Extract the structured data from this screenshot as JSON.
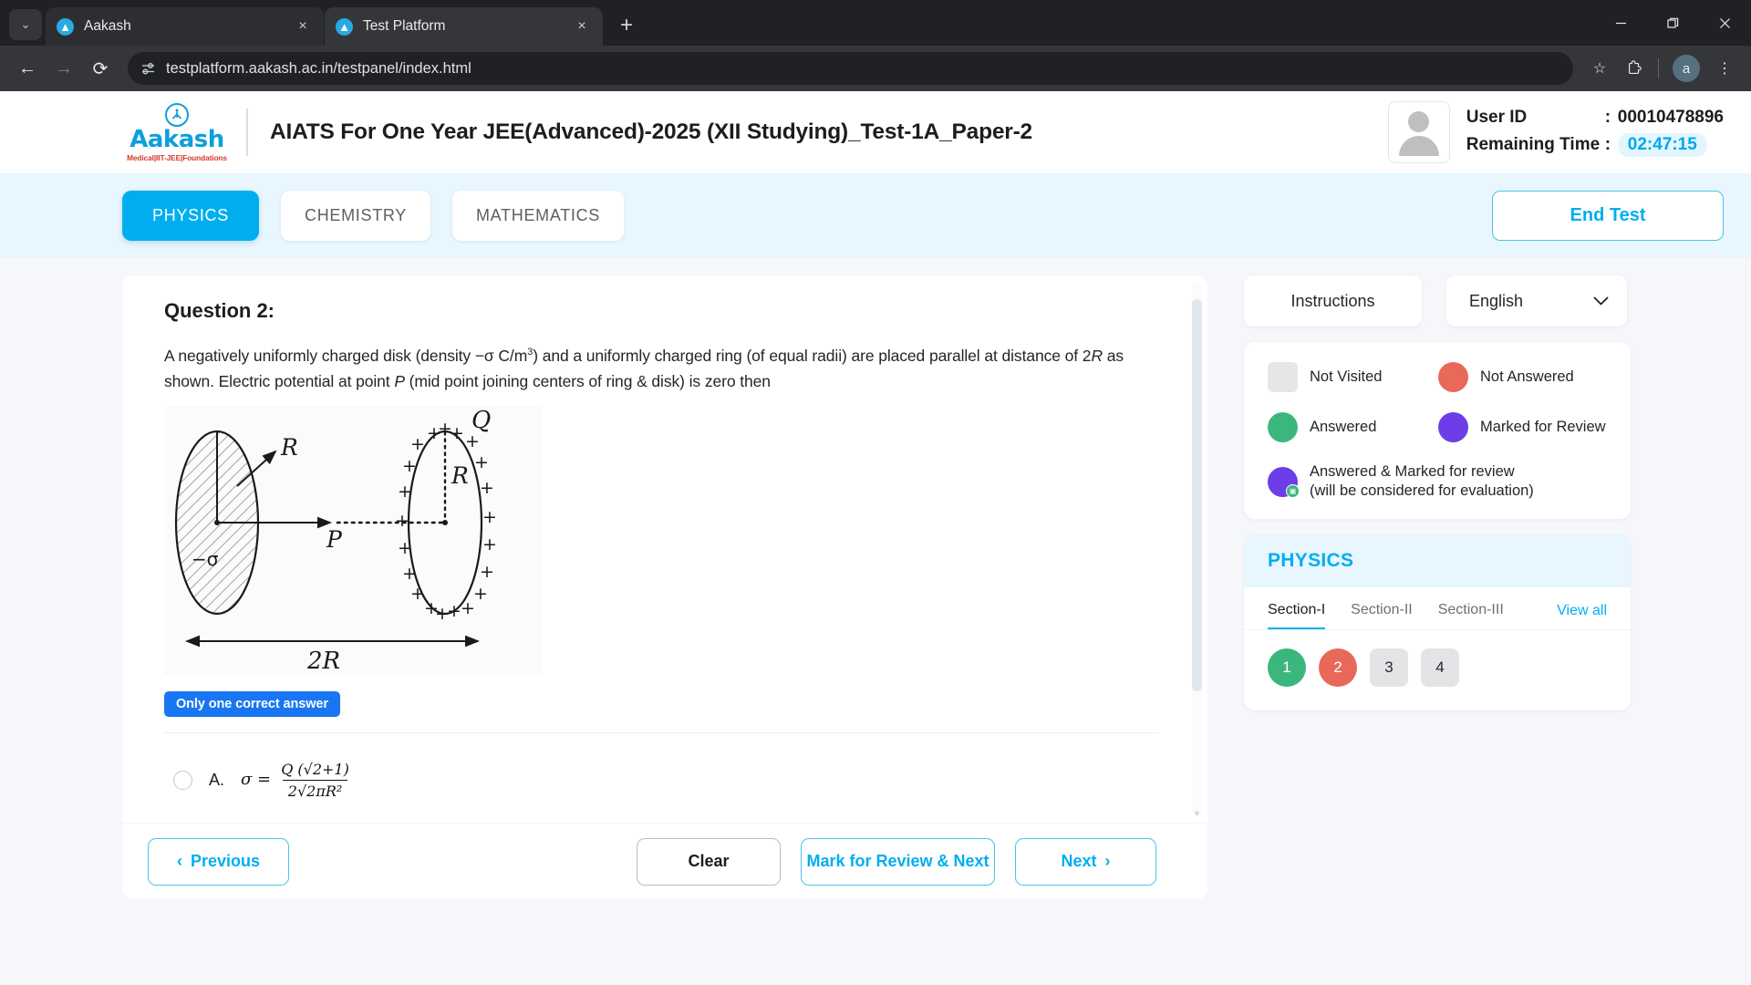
{
  "browser": {
    "tabs": [
      {
        "title": "Aakash",
        "favicon": "aakash-favicon",
        "active": false
      },
      {
        "title": "Test Platform",
        "favicon": "aakash-favicon",
        "active": true
      }
    ],
    "url": "testplatform.aakash.ac.in/testpanel/index.html",
    "profile_initial": "a",
    "new_tab_glyph": "+",
    "tab_close_glyph": "×",
    "tab_search_glyph": "⌄",
    "back_glyph": "←",
    "forward_glyph": "→",
    "reload_glyph": "⟳",
    "site_info_icon": "tune-icon",
    "bookmark_glyph": "☆",
    "extensions_glyph": "⬚",
    "menu_glyph": "⋮",
    "minimize_glyph": "−",
    "maximize_glyph": "❐",
    "close_glyph": "✕"
  },
  "header": {
    "logo_word": "Aakash",
    "logo_tagline": "Medical|IIT-JEE|Foundations",
    "test_title": "AIATS For One Year JEE(Advanced)-2025 (XII Studying)_Test-1A_Paper-2",
    "user_id_label": "User ID",
    "user_id_value": "00010478896",
    "remaining_time_label": "Remaining Time",
    "remaining_time_value": "02:47:15",
    "colon": ":"
  },
  "subject_bar": {
    "tabs": [
      {
        "label": "PHYSICS",
        "active": true
      },
      {
        "label": "CHEMISTRY",
        "active": false
      },
      {
        "label": "MATHEMATICS",
        "active": false
      }
    ],
    "end_test_label": "End Test"
  },
  "question": {
    "title": "Question 2:",
    "text_part1": "A negatively uniformly charged disk (density −σ C/m",
    "text_sup": "3",
    "text_part2": ") and a uniformly charged ring (of equal radii) are placed parallel at distance of 2",
    "italic_R": "R",
    "text_part3": " as shown. Electric potential at point ",
    "italic_P": "P",
    "text_part4": " (mid point joining centers of ring & disk) is zero then",
    "badge": "Only one correct answer",
    "diagram": {
      "label_sigma": "−σ",
      "label_radius_disk": "R",
      "label_point": "P",
      "label_radius_ring": "R",
      "label_charge": "Q",
      "label_distance": "2R",
      "plus_glyph": "+"
    },
    "options": [
      {
        "letter": "A.",
        "lhs": "σ =",
        "numerator": "Q (√2+1)",
        "denominator": "2√2πR²",
        "selected": false
      }
    ]
  },
  "footer": {
    "previous_label": "Previous",
    "previous_glyph": "‹",
    "clear_label": "Clear",
    "mark_review_label": "Mark for Review & Next",
    "next_label": "Next",
    "next_glyph": "›"
  },
  "side_panel": {
    "instructions_label": "Instructions",
    "language_value": "English",
    "chevron_glyph": "⌄",
    "legend": [
      {
        "label": "Not Visited",
        "color": "#e4e6e8",
        "shape": "square"
      },
      {
        "label": "Not Answered",
        "color": "#e8685a",
        "shape": "circle"
      },
      {
        "label": "Answered",
        "color": "#3bb77e",
        "shape": "circle"
      },
      {
        "label": "Marked for Review",
        "color": "#6c3de8",
        "shape": "circle"
      }
    ],
    "legend_wide": {
      "label_line1": "Answered & Marked for review",
      "label_line2": "(will be considered for evaluation)",
      "color": "#6c3de8",
      "badge_color": "#3bb77e",
      "badge_glyph": "▣"
    },
    "palette": {
      "subject": "PHYSICS",
      "sections": [
        {
          "label": "Section-I",
          "active": true
        },
        {
          "label": "Section-II",
          "active": false
        },
        {
          "label": "Section-III",
          "active": false
        }
      ],
      "view_all_label": "View all",
      "questions": [
        {
          "number": "1",
          "state": "answered"
        },
        {
          "number": "2",
          "state": "not-answered"
        },
        {
          "number": "3",
          "state": "not-visited"
        },
        {
          "number": "4",
          "state": "not-visited"
        }
      ]
    }
  }
}
